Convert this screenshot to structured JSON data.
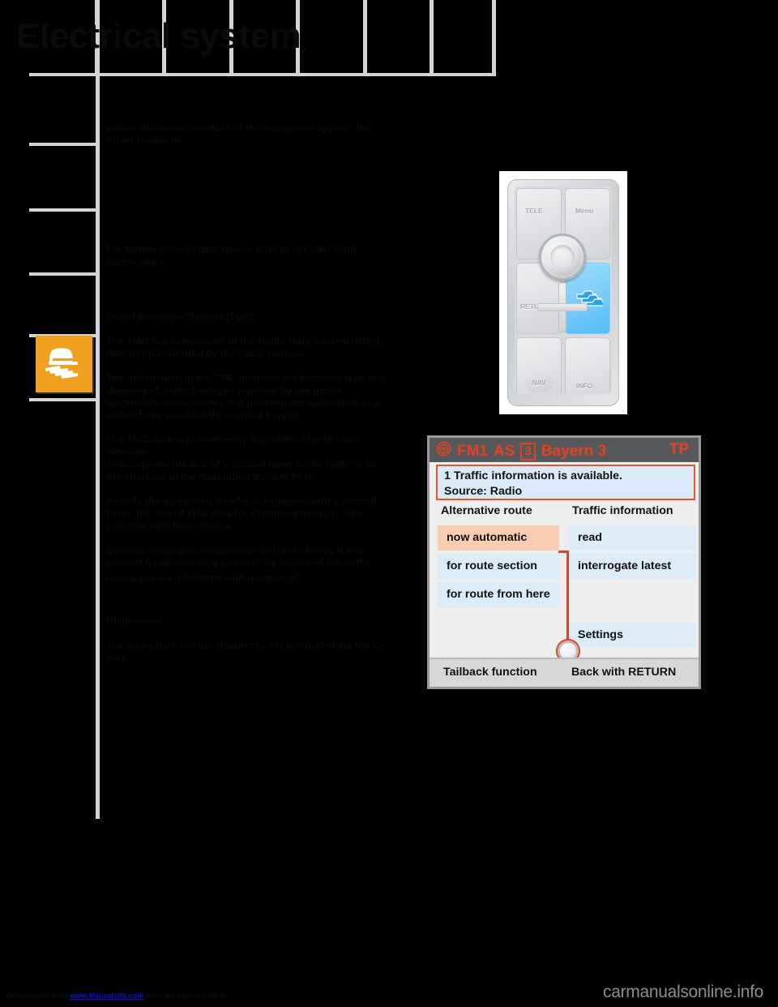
{
  "header": {
    "title": "Electrical system"
  },
  "sidebar": {
    "warning_icon": "slippery-road-warning-icon"
  },
  "body": {
    "intro": "Within the menu structure of the navigation system, the driver is able to",
    "further_info": "For further information, please refer to the operating instructions.",
    "tmc_heading": "Travel Message Channel (TMC)",
    "tmc_p1": "The TMC is a component of the Radio Data System (RDS), which is transmitted by the radio stations.",
    "tmc_p2": "The information in the TMC includes the location, type and duration of traffic hold-ups reported by the police, automobile associations and government authorities in a coded form standard throughout Europe.",
    "tmc_p3a": "The TMC data is not currently transmitted by all radio stations.",
    "tmc_p3b": "This requires the use of a second tuner in the radio or in the interface of the Navigation System Plus.",
    "tmc_p4": "As only the symphony II radio is equipped with a second tuner, the use of TMC data for dynamic routing is only possible with this version.",
    "tmc_p5_pre": "Dynamic routing in conjunction with the chorus II and concert II radios is only possible by means of the traffic messages via telephone with telematics",
    "tmc_p5_sup": "®",
    "tmc_p5_post": ".",
    "diagnostics_heading": "Diagnostics",
    "diagnostics_p1": "The navigation system diagnostics is integrated via the L-wire."
  },
  "control_panel": {
    "tele_label": "TELE",
    "menu_label": "Menu",
    "return_label": "RETURN",
    "nav_label": "NAV",
    "info_label": "INFO",
    "traffic_jam_icon": "traffic-jam-icon",
    "rotary_knob": "rotary-knob",
    "joystick": "cross-joystick"
  },
  "nav_screen": {
    "status_bar": {
      "radio_icon": "radio-waves-icon",
      "band": "FM1",
      "autostore": "AS",
      "preset": "3",
      "station": "Bayern 3",
      "tp": "TP",
      "text_color": "#e8401d",
      "bg_color": "#55595c"
    },
    "message": {
      "line1": "1 Traffic information is available.",
      "line2": "Source: Radio",
      "bg_color": "#d9e9f7",
      "border_color": "#ea5326"
    },
    "columns": {
      "left_header": "Alternative route",
      "right_header": "Traffic information"
    },
    "left_options": [
      {
        "label": "now automatic",
        "selected": true
      },
      {
        "label": "for route section",
        "selected": false
      },
      {
        "label": "for route from here",
        "selected": false
      }
    ],
    "right_options": [
      {
        "label": "read",
        "selected": false
      },
      {
        "label": "interrogate latest",
        "selected": false
      },
      {
        "label": "Settings",
        "selected": false
      }
    ],
    "footer": {
      "left": "Tailback function",
      "right": "Back with RETURN"
    },
    "selection_color": "#f9cdb3",
    "option_color": "#dcebf8",
    "knob_icon": "rotary-knob-indicator"
  },
  "page_footer": {
    "prefix": "Downloaded from ",
    "link": "www.Manualslib.com",
    "suffix": " manuals search engine",
    "watermark": "carmanualsonline.info"
  }
}
